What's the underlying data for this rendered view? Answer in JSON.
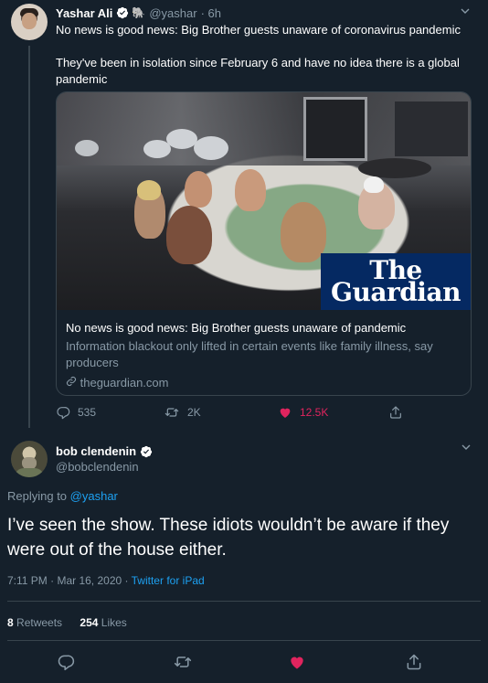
{
  "parent_tweet": {
    "name": "Yashar Ali",
    "emoji": "🐘",
    "handle": "@yashar",
    "time": "· 6h",
    "text_line1": "No news is good news: Big Brother guests unaware of coronavirus pandemic",
    "text_line2": "They've been in isolation since February 6 and have no idea there is a global pandemic",
    "card": {
      "logo_line1": "The",
      "logo_line2": "Guardian",
      "title": "No news is good news: Big Brother guests unaware of pandemic",
      "description": "Information blackout only lifted in certain events like family illness, say producers",
      "domain": "theguardian.com"
    },
    "actions": {
      "replies": "535",
      "retweets": "2K",
      "likes": "12.5K"
    }
  },
  "main_tweet": {
    "name": "bob clendenin",
    "handle": "@bobclendenin",
    "replying_prefix": "Replying to",
    "replying_to": "@yashar",
    "text": "I’ve seen the show. These idiots wouldn’t be aware if they were out of the house either.",
    "timestamp": "7:11 PM · Mar 16, 2020 ·",
    "source": "Twitter for iPad",
    "retweet_count": "8",
    "retweet_label": "Retweets",
    "like_count": "254",
    "like_label": "Likes"
  },
  "colors": {
    "background": "#15202b",
    "muted": "#8899a6",
    "accent": "#1da1f2",
    "like": "#e0245e",
    "divider": "#38444d",
    "guardian": "#052962"
  },
  "icons": [
    "verified-badge-icon",
    "elephant-emoji",
    "chevron-down-icon",
    "reply-icon",
    "retweet-icon",
    "heart-icon",
    "share-icon",
    "link-icon"
  ]
}
